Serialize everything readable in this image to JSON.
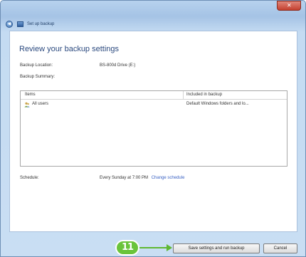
{
  "window": {
    "title": "Set up backup",
    "close_icon": "close-icon",
    "back_icon": "back-arrow-icon"
  },
  "page": {
    "heading": "Review your backup settings",
    "backup_location_label": "Backup Location:",
    "backup_location_value": "BS-800d Drive (E:)",
    "backup_summary_label": "Backup Summary:",
    "schedule_label": "Schedule:",
    "schedule_value": "Every Sunday at 7:00 PM",
    "change_schedule_link": "Change schedule"
  },
  "table": {
    "columns": [
      "Items",
      "Included in backup"
    ],
    "rows": [
      {
        "item": "All users",
        "included": "Default Windows folders and lo...",
        "icon": "users-icon"
      }
    ]
  },
  "footer": {
    "save_button": "Save settings and run backup",
    "cancel_button": "Cancel",
    "callout_badge": "11"
  },
  "colors": {
    "callout_green": "#6ac43b",
    "link_blue": "#3b63c4",
    "heading_blue": "#2c4a7f"
  }
}
